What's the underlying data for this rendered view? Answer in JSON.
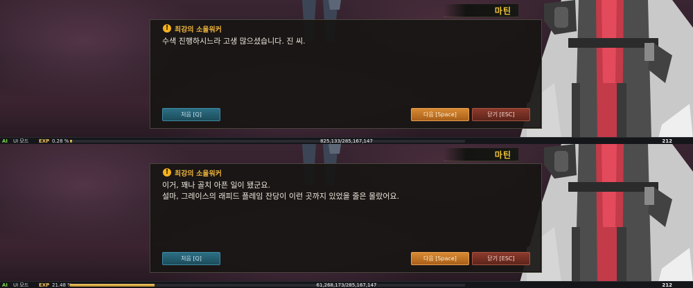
{
  "panels": [
    {
      "npc_name": "마틴",
      "dialog_title": "최강의 소울워커",
      "dialog_text": "수색 진행하시느라 고생 많으셨습니다. 진 씨.",
      "buttons": {
        "first": "처음 [Q]",
        "next": "다음 [Space]",
        "close": "닫기 [ESC]"
      },
      "status": {
        "ai": "AI",
        "ui_mode": "UI 모드",
        "exp_label": "EXP",
        "exp_percent": "0.28 %",
        "exp_fraction": 0.0028,
        "exp_values": "825,133/285,167,147",
        "level": "212"
      }
    },
    {
      "npc_name": "마틴",
      "dialog_title": "최강의 소울워커",
      "dialog_text": "이거, 꽤나 골치 아픈 일이 됐군요.\n설마, 그레이스의 래피드 플레임 잔당이 이런 곳까지 있었을 줄은 몰랐어요.",
      "buttons": {
        "first": "처음 [Q]",
        "next": "다음 [Space]",
        "close": "닫기 [ESC]"
      },
      "status": {
        "ai": "AI",
        "ui_mode": "UI 모드",
        "exp_label": "EXP",
        "exp_percent": "21.48 %",
        "exp_fraction": 0.2148,
        "exp_values": "61,268,173/285,167,147",
        "level": "212"
      }
    }
  ],
  "colors": {
    "accent_gold": "#f2c53a",
    "next_button": "#d88a32",
    "close_button": "#8c3a2c",
    "first_button": "#2c6e83"
  },
  "icons": {
    "title_icon": "exclamation-icon"
  }
}
